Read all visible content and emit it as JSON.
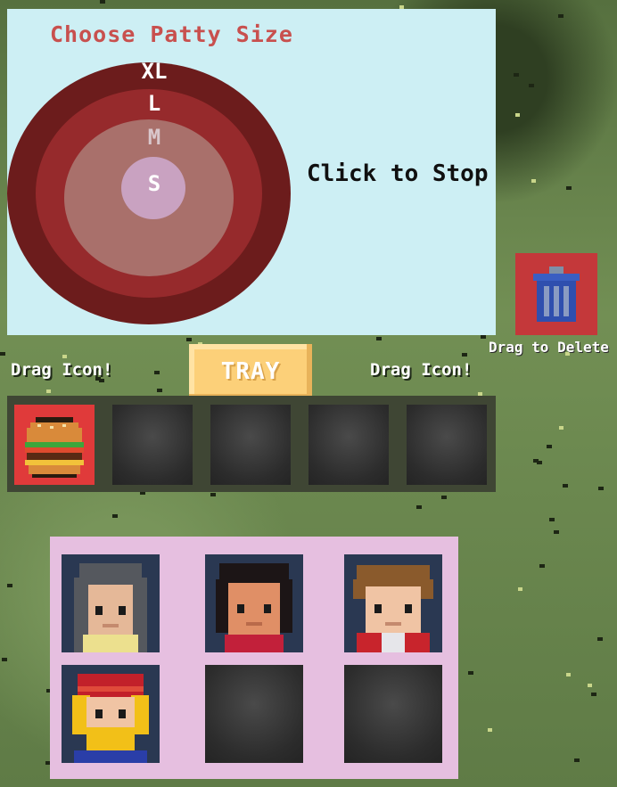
{
  "patty_selector": {
    "title": "Choose Patty Size",
    "sizes": [
      "XL",
      "L",
      "M",
      "S"
    ],
    "instruction": "Click to Stop"
  },
  "trash": {
    "label": "Drag to Delete",
    "icon": "trash-can-icon"
  },
  "tray": {
    "button_label": "TRAY",
    "drag_label_left": "Drag Icon!",
    "drag_label_right": "Drag Icon!",
    "slots": [
      {
        "content": "burger-icon",
        "filled": true
      },
      {
        "content": "",
        "filled": false
      },
      {
        "content": "",
        "filled": false
      },
      {
        "content": "",
        "filled": false
      },
      {
        "content": "",
        "filled": false
      }
    ]
  },
  "customers": {
    "slots": [
      {
        "avatar": "customer-gray-hair-icon",
        "filled": true
      },
      {
        "avatar": "customer-dark-hair-icon",
        "filled": true
      },
      {
        "avatar": "customer-brown-hair-icon",
        "filled": true
      },
      {
        "avatar": "customer-red-hat-icon",
        "filled": true
      },
      {
        "avatar": "",
        "filled": false
      },
      {
        "avatar": "",
        "filled": false
      }
    ]
  },
  "colors": {
    "panel_bg": "#cdeff4",
    "title": "#c8504e",
    "tray_button": "#fcd079",
    "customer_panel": "#e6bfe0",
    "trash_bg": "#c4383a"
  }
}
